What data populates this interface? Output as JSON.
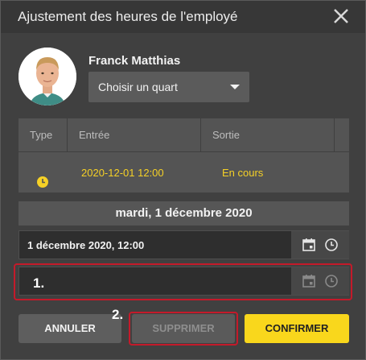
{
  "dialog": {
    "title": "Ajustement des heures de l'employé"
  },
  "employee": {
    "name": "Franck Matthias",
    "shift_select": "Choisir un quart"
  },
  "table": {
    "headers": [
      "Type",
      "Entrée",
      "Sortie"
    ],
    "row": {
      "type_icon": "clock-icon",
      "entry": "2020-12-01 12:00",
      "exit": "En cours"
    }
  },
  "day_header": "mardi, 1 décembre 2020",
  "datetime_rows": [
    {
      "value": "1 décembre 2020, 12:00"
    },
    {
      "value": ""
    }
  ],
  "annotations": {
    "marker_1": "1.",
    "marker_2": "2."
  },
  "buttons": {
    "cancel": "ANNULER",
    "delete": "SUPPRIMER",
    "confirm": "CONFIRMER"
  },
  "colors": {
    "accent": "#f9d71c",
    "highlight": "#c41a2a",
    "panel": "#404040"
  }
}
